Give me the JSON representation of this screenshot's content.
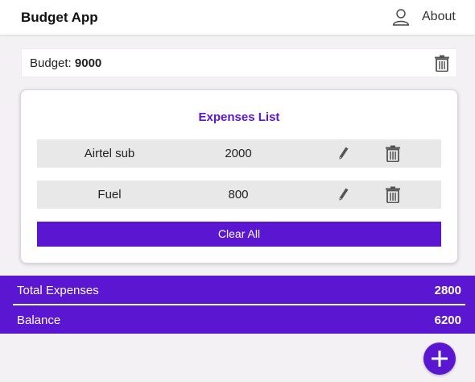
{
  "navbar": {
    "brand": "Budget App",
    "about_label": "About",
    "user_icon": "user-icon"
  },
  "budget": {
    "label": "Budget: ",
    "value": "9000"
  },
  "expenses": {
    "title": "Expenses List",
    "items": [
      {
        "name": "Airtel sub",
        "amount": "2000"
      },
      {
        "name": "Fuel",
        "amount": "800"
      }
    ],
    "clear_label": "Clear All"
  },
  "summary": {
    "total_label": "Total Expenses",
    "total_value": "2800",
    "balance_label": "Balance",
    "balance_value": "6200"
  },
  "colors": {
    "accent": "#5a16d1",
    "row_bg": "#e8e8e8",
    "page_bg": "#f3f1f3"
  },
  "icons": {
    "add": "plus-icon",
    "edit": "pencil-icon",
    "delete": "trash-icon"
  }
}
